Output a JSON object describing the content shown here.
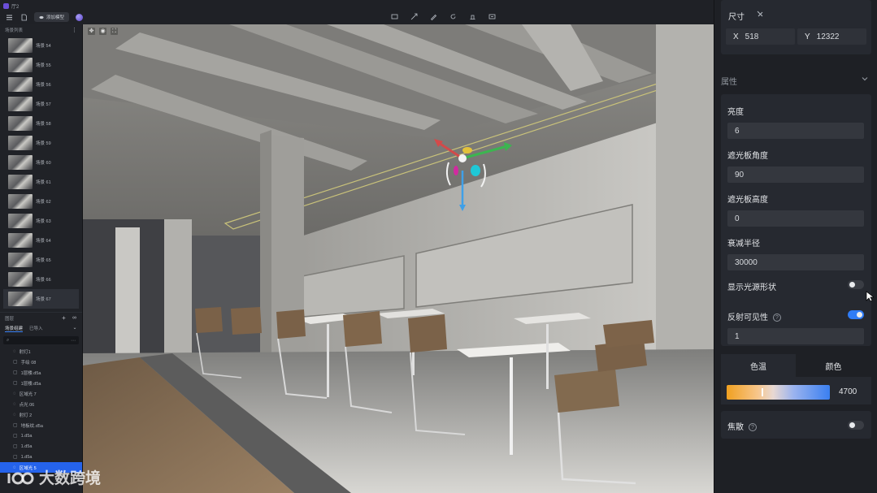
{
  "app": {
    "title": "厅2",
    "toolbar": {
      "pill_label": "添加模型"
    }
  },
  "left": {
    "scenes_header": "场景列表",
    "scenes": [
      {
        "label": "场景 54",
        "selected": false
      },
      {
        "label": "场景 55",
        "selected": false
      },
      {
        "label": "场景 56",
        "selected": false
      },
      {
        "label": "场景 57",
        "selected": false
      },
      {
        "label": "场景 58",
        "selected": false
      },
      {
        "label": "场景 59",
        "selected": false
      },
      {
        "label": "场景 60",
        "selected": false
      },
      {
        "label": "场景 61",
        "selected": false
      },
      {
        "label": "场景 62",
        "selected": false
      },
      {
        "label": "场景 63",
        "selected": false
      },
      {
        "label": "场景 64",
        "selected": false
      },
      {
        "label": "场景 65",
        "selected": false
      },
      {
        "label": "场景 66",
        "selected": false
      },
      {
        "label": "场景 67",
        "selected": true
      }
    ],
    "layers_header": "图层",
    "tabs": [
      {
        "label": "场景组建",
        "active": true
      },
      {
        "label": "已导入",
        "active": false
      }
    ],
    "tree": [
      {
        "label": "射灯1",
        "icon": "light-icon",
        "selected": false
      },
      {
        "label": "手绘 08",
        "icon": "model-icon",
        "selected": false
      },
      {
        "label": "1层楼.d5a",
        "icon": "model-icon",
        "selected": false
      },
      {
        "label": "1层楼.d5a",
        "icon": "model-icon",
        "selected": false
      },
      {
        "label": "区域光 7",
        "icon": "light-icon",
        "selected": false
      },
      {
        "label": "点光 06",
        "icon": "light-icon",
        "selected": false
      },
      {
        "label": "射灯 2",
        "icon": "light-icon",
        "selected": false
      },
      {
        "label": "地板纹.d5a",
        "icon": "model-icon",
        "selected": false
      },
      {
        "label": "1.d5a",
        "icon": "model-icon",
        "selected": false
      },
      {
        "label": "1.d5a",
        "icon": "model-icon",
        "selected": false
      },
      {
        "label": "1.d5a",
        "icon": "model-icon",
        "selected": false
      },
      {
        "label": "区域光 5",
        "icon": "light-icon",
        "selected": true
      }
    ]
  },
  "right": {
    "size": {
      "label": "尺寸",
      "x_label": "X",
      "x_value": "518",
      "y_label": "Y",
      "y_value": "12322"
    },
    "section_title": "属性",
    "brightness": {
      "label": "亮度",
      "value": "6"
    },
    "barn_angle": {
      "label": "遮光板角度",
      "value": "90"
    },
    "barn_height": {
      "label": "遮光板高度",
      "value": "0"
    },
    "attenuation": {
      "label": "衰减半径",
      "value": "30000"
    },
    "show_shape": {
      "label": "显示光源形状",
      "on": false
    },
    "reflection": {
      "label": "反射可见性",
      "on": true,
      "value": "1"
    },
    "color_tabs": [
      {
        "label": "色温",
        "active": true
      },
      {
        "label": "颜色",
        "active": false
      }
    ],
    "color_temp": {
      "value": "4700",
      "fraction": 0.34
    },
    "focus": {
      "label": "焦散",
      "on": false
    }
  },
  "watermark": "大数跨境",
  "colors": {
    "accent": "#2f7cf6",
    "panel": "#1e2025",
    "temp_warm": "#f0a020",
    "temp_cool": "#3a7ff0"
  }
}
